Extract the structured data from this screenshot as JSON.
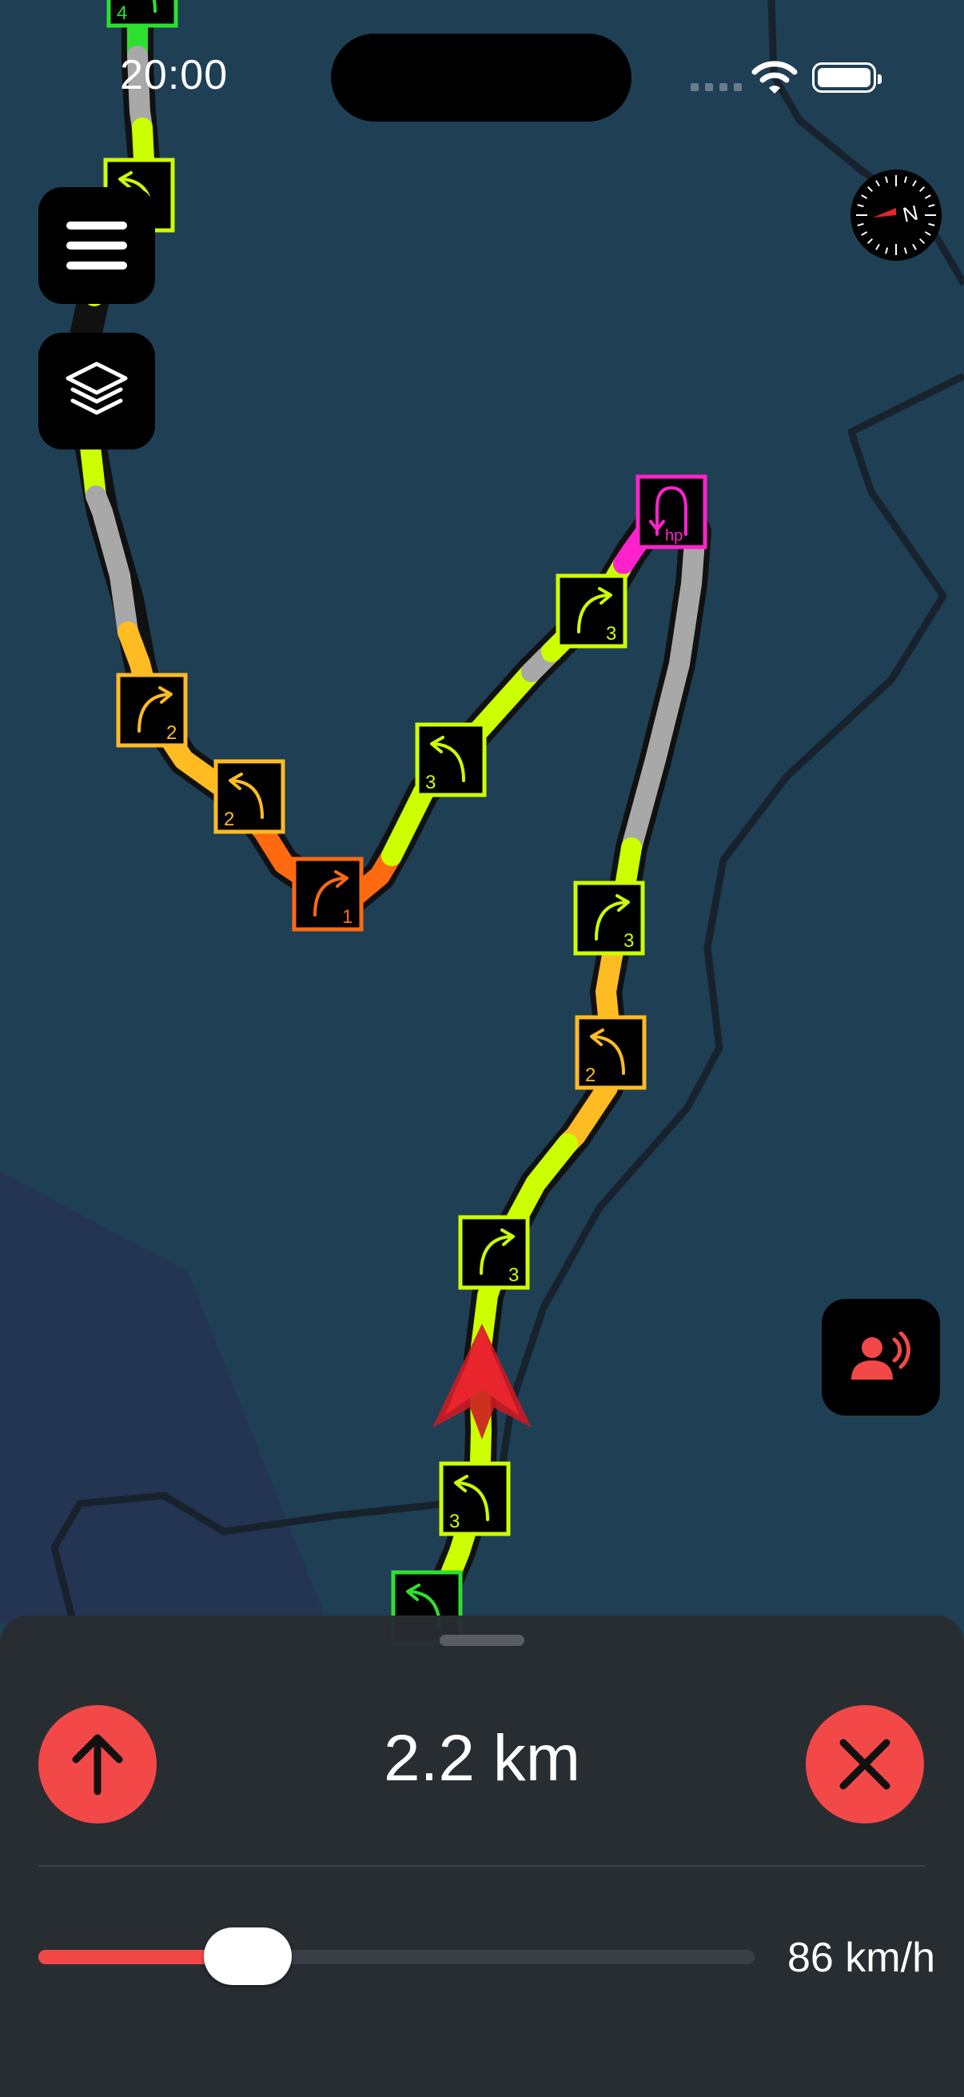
{
  "status_bar": {
    "time": "20:00"
  },
  "map": {
    "colors": {
      "water": "#1f3f55",
      "land": "#243553",
      "border": "#17222d",
      "route_outline": "#111",
      "severity_3": "#ccff00",
      "severity_2": "#ffbb22",
      "severity_1": "#ff6a10",
      "hairpin": "#ff22cc",
      "easy": "#2ee02e",
      "unknown": "#a8a8a8"
    },
    "curve_signs": [
      {
        "name": "curve-sign-4",
        "number": "4",
        "direction": "left",
        "severity": "easy"
      },
      {
        "name": "curve-sign-top-left",
        "number": "",
        "direction": "left",
        "severity": "severity_3"
      },
      {
        "name": "curve-sign-2a",
        "number": "2",
        "direction": "right",
        "severity": "severity_2"
      },
      {
        "name": "curve-sign-2b",
        "number": "2",
        "direction": "left",
        "severity": "severity_2"
      },
      {
        "name": "curve-sign-1",
        "number": "1",
        "direction": "right",
        "severity": "severity_1"
      },
      {
        "name": "curve-sign-3a",
        "number": "3",
        "direction": "left",
        "severity": "severity_3"
      },
      {
        "name": "curve-sign-3b",
        "number": "3",
        "direction": "right",
        "severity": "severity_3"
      },
      {
        "name": "hairpin-sign",
        "number": "hp",
        "direction": "hairpin",
        "severity": "hairpin"
      },
      {
        "name": "curve-sign-3c",
        "number": "3",
        "direction": "right",
        "severity": "severity_3"
      },
      {
        "name": "curve-sign-2c",
        "number": "2",
        "direction": "left",
        "severity": "severity_2"
      },
      {
        "name": "curve-sign-3d",
        "number": "3",
        "direction": "right",
        "severity": "severity_3"
      },
      {
        "name": "curve-sign-3e",
        "number": "3",
        "direction": "left",
        "severity": "severity_3"
      },
      {
        "name": "curve-sign-bottom",
        "number": "",
        "direction": "left",
        "severity": "easy"
      }
    ]
  },
  "controls": {
    "menu_icon": "hamburger-icon",
    "layers_icon": "layers-icon",
    "compass_label": "N",
    "voice_icon": "speaker-person-icon"
  },
  "bottom_sheet": {
    "distance": "2.2 km",
    "speed_label": "86 km/h",
    "speed_fraction": 0.27,
    "accent_color": "#f24848"
  }
}
